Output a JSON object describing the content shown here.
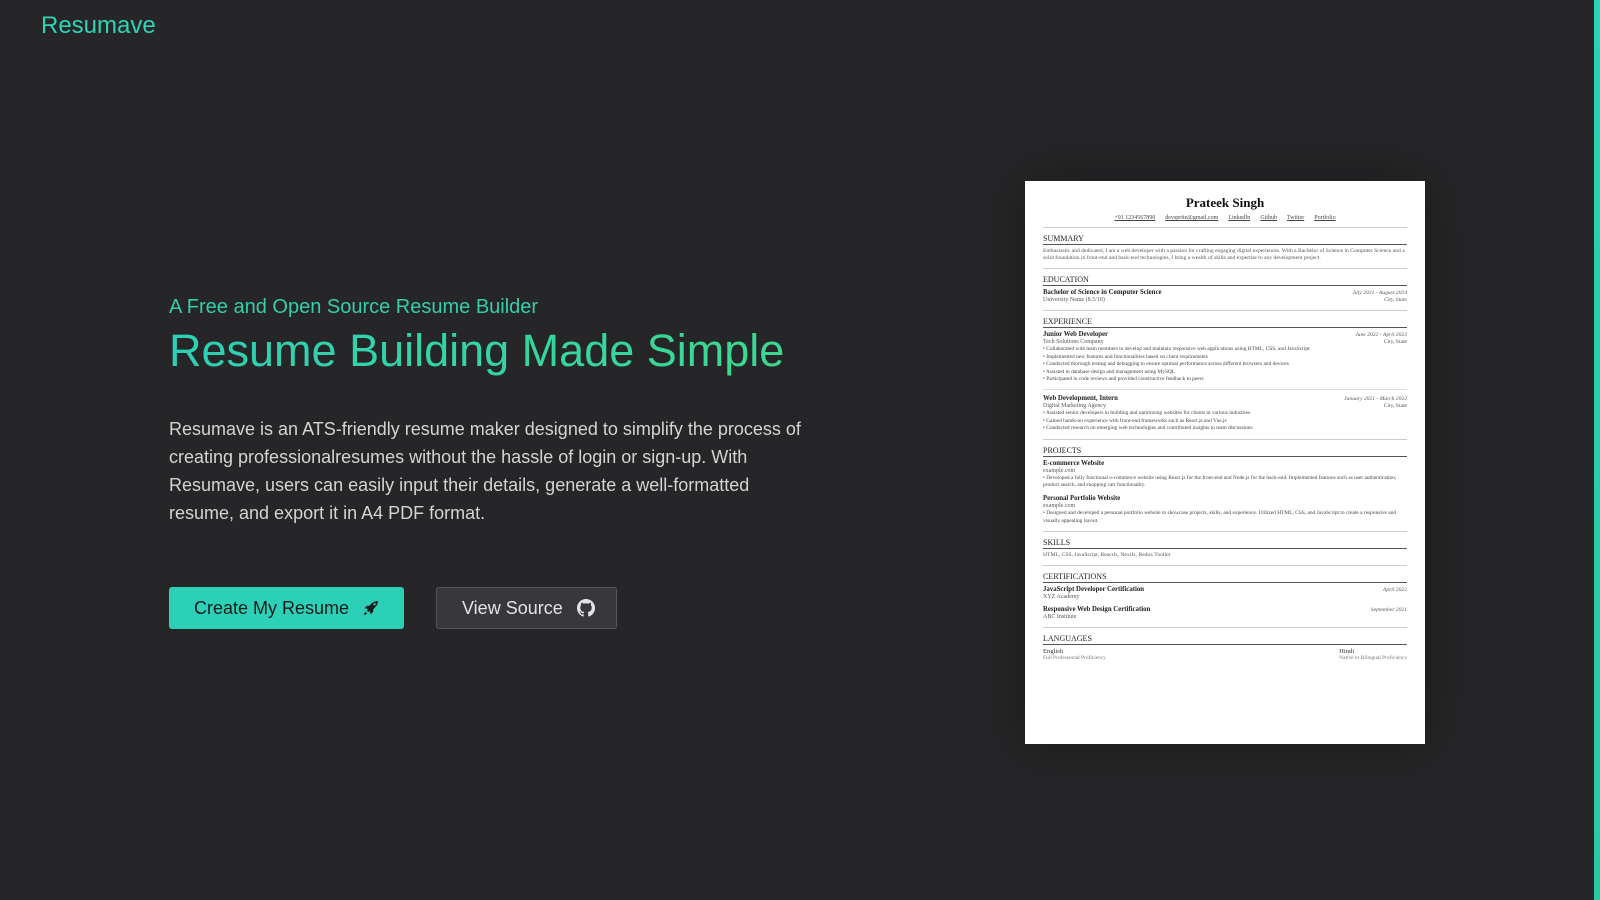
{
  "header": {
    "logo": "Resumave"
  },
  "hero": {
    "tagline": "A Free and Open Source Resume Builder",
    "headline": "Resume Building Made Simple",
    "description": "Resumave is an ATS-friendly resume maker designed to simplify the process of creating professionalresumes without the hassle of login or sign-up. With Resumave, users can easily input their details, generate a well-formatted resume, and export it in A4 PDF format."
  },
  "buttons": {
    "primary": {
      "label": "Create My Resume",
      "icon": "rocket-icon"
    },
    "secondary": {
      "label": "View Source",
      "icon": "github-icon"
    }
  },
  "colors": {
    "accent": "#2bd0b6",
    "accent_end": "#3dd98d",
    "background": "#262628"
  },
  "resume": {
    "name": "Prateek Singh",
    "contacts": [
      "+91 1234567890",
      "devsprite@gmail.com",
      "LinkedIn",
      "Github",
      "Twitter",
      "Portfolio"
    ],
    "summary": {
      "title": "SUMMARY",
      "text": "Enthusiastic and dedicated, I am a web developer with a passion for crafting engaging digital experiences. With a Bachelor of Science in Computer Science and a solid foundation in front-end and back-end technologies, I bring a wealth of skills and expertise to any development project."
    },
    "education": {
      "title": "EDUCATION",
      "degree": "Bachelor of Science in Computer Science",
      "dates": "July 2021 - August 2024",
      "school": "University Name (8.5/10)",
      "location": "City, State"
    },
    "experience": {
      "title": "EXPERIENCE",
      "jobs": [
        {
          "role": "Junior Web Developer",
          "dates": "June 2022 - April 2023",
          "company": "Tech Solutions Company",
          "location": "City, State",
          "bullets": [
            "• Collaborated with team members to develop and maintain responsive web applications using HTML, CSS, and JavaScript",
            "• Implemented new features and functionalities based on client requirements",
            "• Conducted thorough testing and debugging to ensure optimal performance across different browsers and devices",
            "• Assisted in database design and management using MySQL",
            "• Participated in code reviews and provided constructive feedback to peers"
          ]
        },
        {
          "role": "Web Development, Intern",
          "dates": "January 2021 - March 2022",
          "company": "Digital Marketing Agency",
          "location": "City, State",
          "bullets": [
            "• Assisted senior developers in building and optimizing websites for clients in various industries",
            "• Gained hands-on experience with front-end frameworks such as React.js and Vue.js",
            "• Conducted research on emerging web technologies and contributed insights to team discussions"
          ]
        }
      ]
    },
    "projects": {
      "title": "PROJECTS",
      "items": [
        {
          "name": "E-commerce Website",
          "link": "example.com",
          "bullet": "• Developed a fully functional e-commerce website using React.js for the front-end and Node.js for the back-end. Implemented features such as user authentication, product search, and shopping cart functionality."
        },
        {
          "name": "Personal Portfolio Website",
          "link": "example.com",
          "bullet": "• Designed and developed a personal portfolio website to showcase projects, skills, and experience. Utilized HTML, CSS, and JavaScript to create a responsive and visually appealing layout."
        }
      ]
    },
    "skills": {
      "title": "SKILLS",
      "text": "HTML, CSS, JavaScript, ReactJs, NextJs, Redux Toolkit"
    },
    "certifications": {
      "title": "CERTIFICATIONS",
      "items": [
        {
          "name": "JavaScript Developer Certification",
          "date": "April 2022",
          "issuer": "XYZ Academy"
        },
        {
          "name": "Responsive Web Design Certification",
          "date": "September 2021",
          "issuer": "ABC Institute"
        }
      ]
    },
    "languages": {
      "title": "LANGUAGES",
      "items": [
        {
          "name": "English",
          "level": "Full Professional Proficiency"
        },
        {
          "name": "Hindi",
          "level": "Native or Bilingual Proficiency"
        }
      ]
    }
  }
}
